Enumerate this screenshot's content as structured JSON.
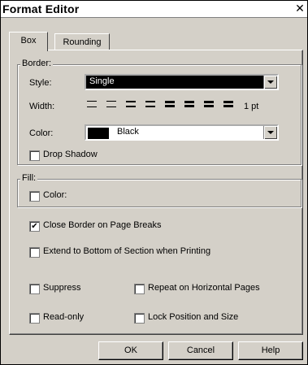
{
  "window": {
    "title": "Format Editor",
    "close_glyph": "✕"
  },
  "tabs": [
    {
      "label": "Box",
      "active": true
    },
    {
      "label": "Rounding",
      "active": false
    }
  ],
  "border": {
    "legend": "Border:",
    "style_label": "Style:",
    "style_value": "Single",
    "width_label": "Width:",
    "width_unit": "1 pt",
    "width_icons": [
      "line-width-1",
      "line-width-2",
      "line-width-3",
      "line-width-4",
      "line-width-5",
      "line-width-6",
      "line-width-7",
      "line-width-8"
    ],
    "color_label": "Color:",
    "color_value": "Black",
    "drop_shadow_label": "Drop Shadow",
    "drop_shadow_checked": false
  },
  "fill": {
    "legend": "Fill:",
    "color_label": "Color:",
    "color_checked": false
  },
  "options": {
    "close_border": {
      "label": "Close Border on Page Breaks",
      "checked": true
    },
    "extend_bottom": {
      "label": "Extend to Bottom of Section when Printing",
      "checked": false
    },
    "suppress": {
      "label": "Suppress",
      "checked": false
    },
    "repeat_horizontal": {
      "label": "Repeat on Horizontal Pages",
      "checked": false
    },
    "read_only": {
      "label": "Read-only",
      "checked": false
    },
    "lock_position": {
      "label": "Lock Position and Size",
      "checked": false
    }
  },
  "buttons": {
    "ok": "OK",
    "cancel": "Cancel",
    "help": "Help"
  },
  "colors": {
    "face": "#d4d0c8",
    "highlight": "#ffffff",
    "shadow": "#808080",
    "dark": "#000000"
  }
}
